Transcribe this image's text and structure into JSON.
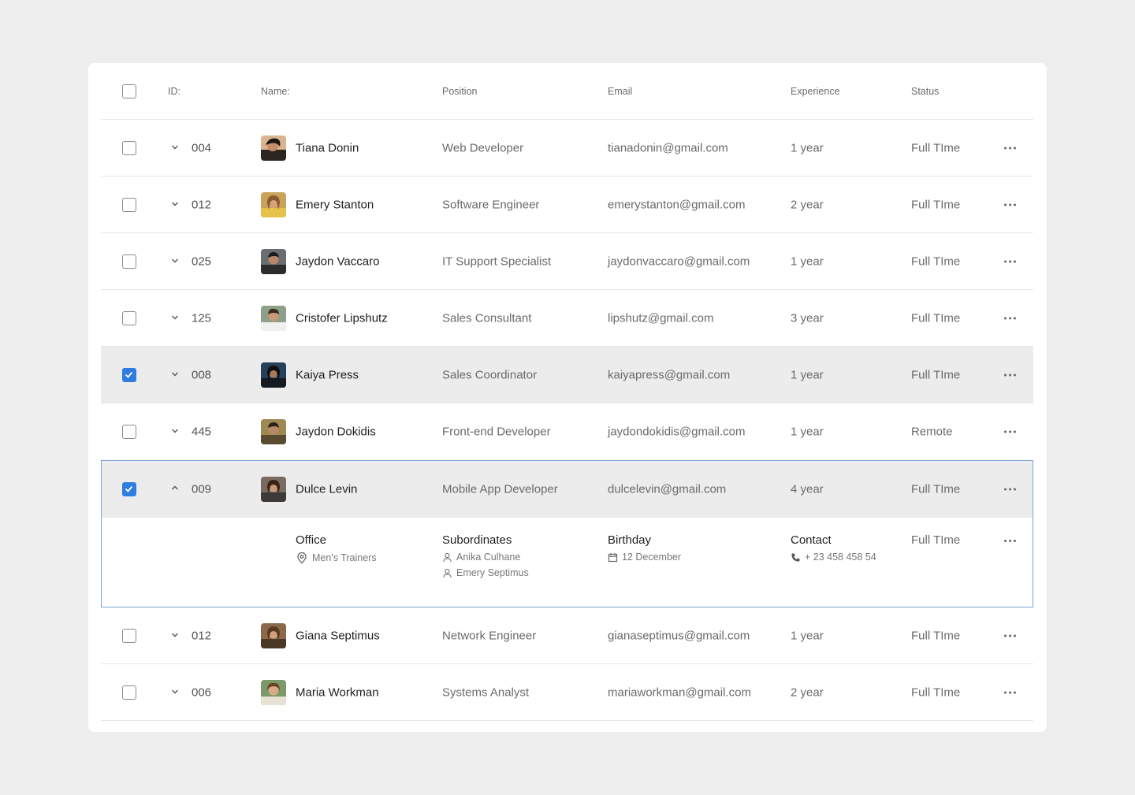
{
  "header": {
    "id": "ID:",
    "name": "Name:",
    "position": "Position",
    "email": "Email",
    "experience": "Experience",
    "status": "Status"
  },
  "rows": [
    {
      "id": "004",
      "name": "Tiana Donin",
      "position": "Web Developer",
      "email": "tianadonin@gmail.com",
      "experience": "1 year",
      "status": "Full TIme",
      "checked": false
    },
    {
      "id": "012",
      "name": "Emery Stanton",
      "position": "Software Engineer",
      "email": "emerystanton@gmail.com",
      "experience": "2 year",
      "status": "Full TIme",
      "checked": false
    },
    {
      "id": "025",
      "name": "Jaydon Vaccaro",
      "position": "IT Support Specialist",
      "email": "jaydonvaccaro@gmail.com",
      "experience": "1 year",
      "status": "Full TIme",
      "checked": false
    },
    {
      "id": "125",
      "name": "Cristofer Lipshutz",
      "position": "Sales Consultant",
      "email": "lipshutz@gmail.com",
      "experience": "3 year",
      "status": "Full TIme",
      "checked": false
    },
    {
      "id": "008",
      "name": "Kaiya Press",
      "position": "Sales Coordinator",
      "email": "kaiyapress@gmail.com",
      "experience": "1 year",
      "status": "Full TIme",
      "checked": true
    },
    {
      "id": "445",
      "name": "Jaydon Dokidis",
      "position": "Front-end Developer",
      "email": "jaydondokidis@gmail.com",
      "experience": "1 year",
      "status": "Remote",
      "checked": false
    },
    {
      "id": "009",
      "name": "Dulce Levin",
      "position": "Mobile App Developer",
      "email": "dulcelevin@gmail.com",
      "experience": "4 year",
      "status": "Full TIme",
      "checked": true
    },
    {
      "id": "012",
      "name": "Giana Septimus",
      "position": "Network Engineer",
      "email": "gianaseptimus@gmail.com",
      "experience": "1 year",
      "status": "Full TIme",
      "checked": false
    },
    {
      "id": "006",
      "name": "Maria Workman",
      "position": "Systems Analyst",
      "email": "mariaworkman@gmail.com",
      "experience": "2 year",
      "status": "Full TIme",
      "checked": false
    }
  ],
  "detail": {
    "office_title": "Office",
    "office_value": "Men's Trainers",
    "subordinates_title": "Subordinates",
    "subordinates": [
      "Anika Culhane",
      "Emery Septimus"
    ],
    "birthday_title": "Birthday",
    "birthday_value": "12 December",
    "contact_title": "Contact",
    "contact_value": "+ 23 458 458 54",
    "status": "Full TIme"
  },
  "colors": {
    "accent": "#2f7de1",
    "selected_row": "#ececec",
    "expanded_border": "#7aa3d6"
  },
  "icons": {
    "expand": "chevron-down-icon",
    "collapse": "chevron-up-icon",
    "actions": "more-horizontal-icon",
    "office": "map-pin-icon",
    "person": "user-icon",
    "calendar": "calendar-icon",
    "phone": "phone-icon"
  }
}
